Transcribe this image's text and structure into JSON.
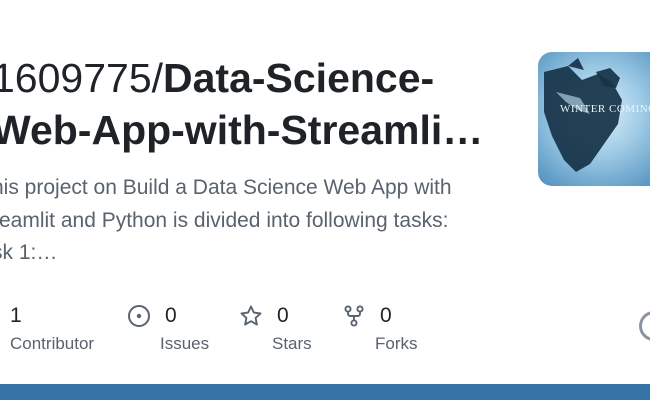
{
  "repo": {
    "title_line1_owner": "1609775/",
    "title_line1_repo": "Data-Science-",
    "title_line2": "Web-App-with-Streamli…",
    "description_lines": [
      "his project on Build a Data Science Web App with",
      "reamlit and Python is divided into following tasks:",
      "sk 1:…"
    ],
    "avatar_text": "WINTER COMING"
  },
  "stats": [
    {
      "value": "1",
      "label": "Contributor",
      "icon": "people-icon"
    },
    {
      "value": "0",
      "label": "Issues",
      "icon": "issue-opened-icon"
    },
    {
      "value": "0",
      "label": "Stars",
      "icon": "star-icon"
    },
    {
      "value": "0",
      "label": "Forks",
      "icon": "repo-forked-icon"
    }
  ],
  "colors": {
    "language_bar": "#3572A5",
    "text_primary": "#1f2328",
    "text_muted": "#59636e"
  }
}
